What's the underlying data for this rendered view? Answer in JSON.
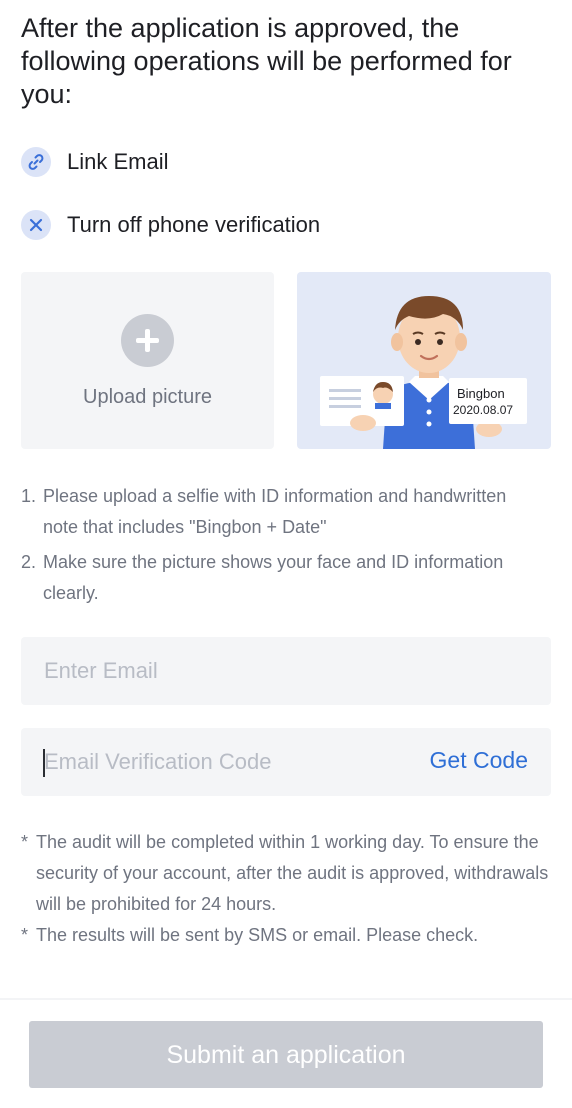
{
  "heading": "After the application is approved, the following operations will be performed for you:",
  "operations": [
    {
      "icon": "link-icon",
      "label": "Link Email"
    },
    {
      "icon": "close-icon",
      "label": "Turn off phone verification"
    }
  ],
  "upload": {
    "label": "Upload picture",
    "example_card_name": "Bingbon",
    "example_card_date": "2020.08.07"
  },
  "instructions": [
    {
      "num": "1.",
      "text": "Please upload a selfie with ID information and handwritten note that includes \"Bingbon + Date\""
    },
    {
      "num": "2.",
      "text": "Make sure the picture shows your face and ID information clearly."
    }
  ],
  "email_field": {
    "placeholder": "Enter Email",
    "value": ""
  },
  "code_field": {
    "placeholder": "Email Verification Code",
    "value": "",
    "get_code_label": "Get Code"
  },
  "notes": [
    {
      "mark": "*",
      "text": "The audit will be completed within 1 working day. To ensure the security of your account, after the audit is approved, withdrawals will be prohibited for 24 hours."
    },
    {
      "mark": "*",
      "text": "The results will be sent by SMS or email. Please check."
    }
  ],
  "submit_label": "Submit an application",
  "colors": {
    "accent": "#2f6fd6",
    "icon_bg": "#dbe3f7",
    "disabled_button": "#c9ccd3",
    "muted_text": "#6f7480",
    "field_bg": "#f4f5f7"
  }
}
